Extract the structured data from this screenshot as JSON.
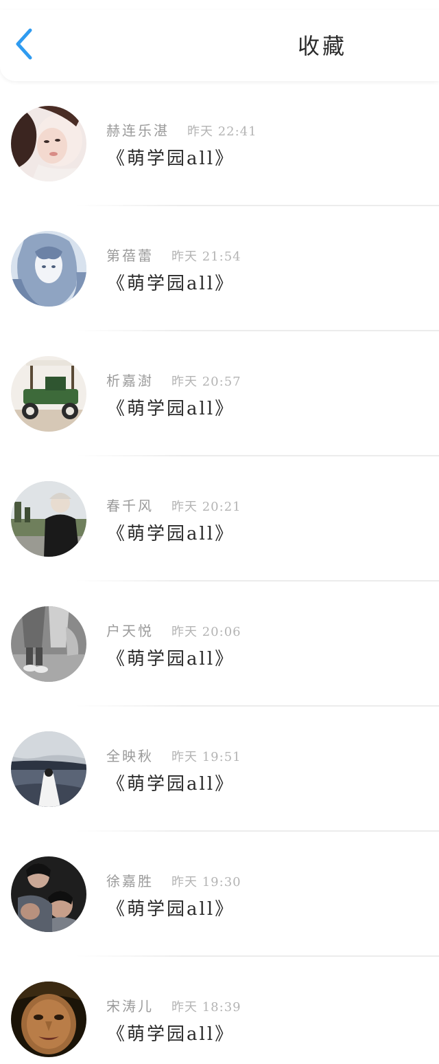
{
  "header": {
    "title": "收藏"
  },
  "favorites": [
    {
      "name": "赫连乐湛",
      "time": "昨天 22:41",
      "work": "《萌学园all》",
      "avatar": "avatar-woman-portrait"
    },
    {
      "name": "第蓓蕾",
      "time": "昨天 21:54",
      "work": "《萌学园all》",
      "avatar": "avatar-anime-girl"
    },
    {
      "name": "析嘉澍",
      "time": "昨天 20:57",
      "work": "《萌学园all》",
      "avatar": "avatar-vintage-car"
    },
    {
      "name": "春千风",
      "time": "昨天 20:21",
      "work": "《萌学园all》",
      "avatar": "avatar-boy-cap"
    },
    {
      "name": "户天悦",
      "time": "昨天 20:06",
      "work": "《萌学园all》",
      "avatar": "avatar-couple-feet"
    },
    {
      "name": "全映秋",
      "time": "昨天 19:51",
      "work": "《萌学园all》",
      "avatar": "avatar-lake-scene"
    },
    {
      "name": "徐嘉胜",
      "time": "昨天 19:30",
      "work": "《萌学园all》",
      "avatar": "avatar-group-photo"
    },
    {
      "name": "宋涛儿",
      "time": "昨天 18:39",
      "work": "《萌学园all》",
      "avatar": "avatar-face-closeup"
    }
  ],
  "colors": {
    "accent": "#2f9bf0",
    "title": "#2b2b2b",
    "name": "#9a9a9a",
    "time": "#b4b4b4"
  }
}
